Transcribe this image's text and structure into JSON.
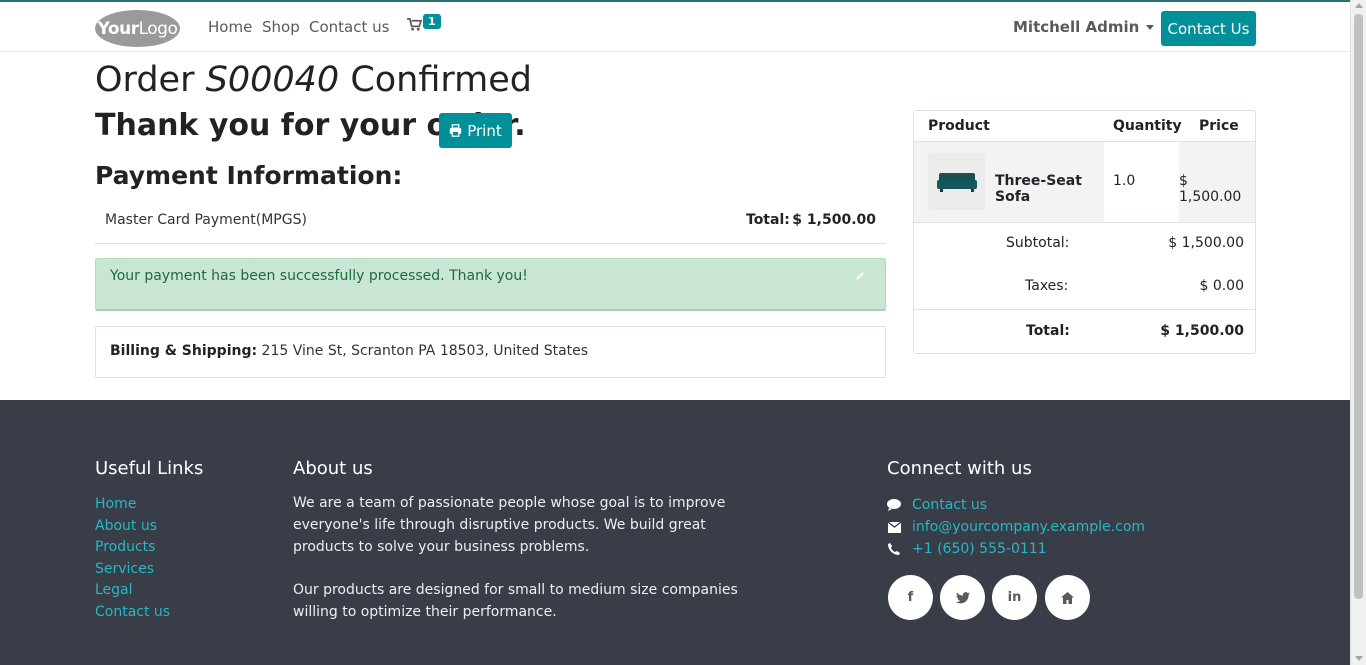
{
  "header": {
    "logo": {
      "bold": "Your",
      "thin": "Logo"
    },
    "nav": [
      {
        "label": "Home"
      },
      {
        "label": "Shop"
      },
      {
        "label": "Contact us"
      }
    ],
    "cart_count": "1",
    "user_name": "Mitchell Admin",
    "contact_button": "Contact Us"
  },
  "order": {
    "title_prefix": "Order",
    "order_ref": "S00040",
    "title_suffix": "Confirmed",
    "thanks": "Thank you for your order.",
    "print_label": "Print",
    "payment_heading": "Payment Information:",
    "payment_method": "Master Card Payment(MPGS)",
    "payment_total_label": "Total:",
    "payment_total_value": "$ 1,500.00",
    "alert_message": "Your payment has been successfully processed. Thank you!",
    "billing_label": "Billing & Shipping:",
    "billing_address": "215 Vine St, Scranton PA 18503, United States"
  },
  "summary": {
    "headers": {
      "product": "Product",
      "quantity": "Quantity",
      "price": "Price"
    },
    "items": [
      {
        "name": "Three-Seat Sofa",
        "quantity": "1.0",
        "price": "$ 1,500.00"
      }
    ],
    "subtotal_label": "Subtotal:",
    "subtotal_value": "$ 1,500.00",
    "taxes_label": "Taxes:",
    "taxes_value": "$ 0.00",
    "total_label": "Total:",
    "total_value": "$ 1,500.00"
  },
  "footer": {
    "useful_links_heading": "Useful Links",
    "useful_links": [
      "Home",
      "About us",
      "Products",
      "Services",
      "Legal",
      "Contact us"
    ],
    "about_heading": "About us",
    "about_paragraphs": [
      "We are a team of passionate people whose goal is to improve everyone's life through disruptive products. We build great products to solve your business problems.",
      "Our products are designed for small to medium size companies willing to optimize their performance."
    ],
    "connect_heading": "Connect with us",
    "connect": {
      "contact": "Contact us",
      "email": "info@yourcompany.example.com",
      "phone": "+1 (650) 555-0111"
    },
    "social": [
      "facebook-icon",
      "twitter-icon",
      "linkedin-icon",
      "home-icon"
    ]
  },
  "colors": {
    "accent": "#00909a",
    "link": "#26b8c4",
    "footer_bg": "#383d47",
    "success_bg": "#c8e6d3",
    "success_text": "#1e6b3a",
    "corner_badge": "#6c4a7e"
  }
}
